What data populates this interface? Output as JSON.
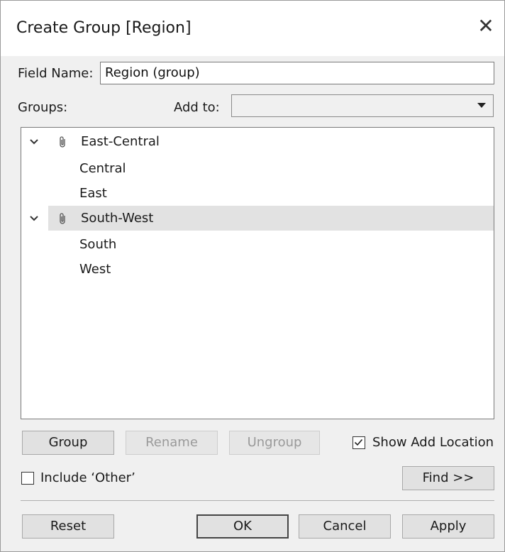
{
  "dialog": {
    "title": "Create Group [Region]",
    "close_icon": "close-icon"
  },
  "field_name": {
    "label": "Field Name:",
    "value": "Region (group)"
  },
  "groups_label": "Groups:",
  "add_to": {
    "label": "Add to:",
    "value": ""
  },
  "tree": {
    "groups": [
      {
        "name": "East-Central",
        "expanded": true,
        "selected": false,
        "members": [
          "Central",
          "East"
        ]
      },
      {
        "name": "South-West",
        "expanded": true,
        "selected": true,
        "members": [
          "South",
          "West"
        ]
      }
    ]
  },
  "buttons": {
    "group": "Group",
    "rename": "Rename",
    "ungroup": "Ungroup",
    "find": "Find >>",
    "reset": "Reset",
    "ok": "OK",
    "cancel": "Cancel",
    "apply": "Apply"
  },
  "options": {
    "show_add_location": {
      "label": "Show Add Location",
      "checked": true
    },
    "include_other": {
      "label": "Include ‘Other’",
      "checked": false
    }
  }
}
